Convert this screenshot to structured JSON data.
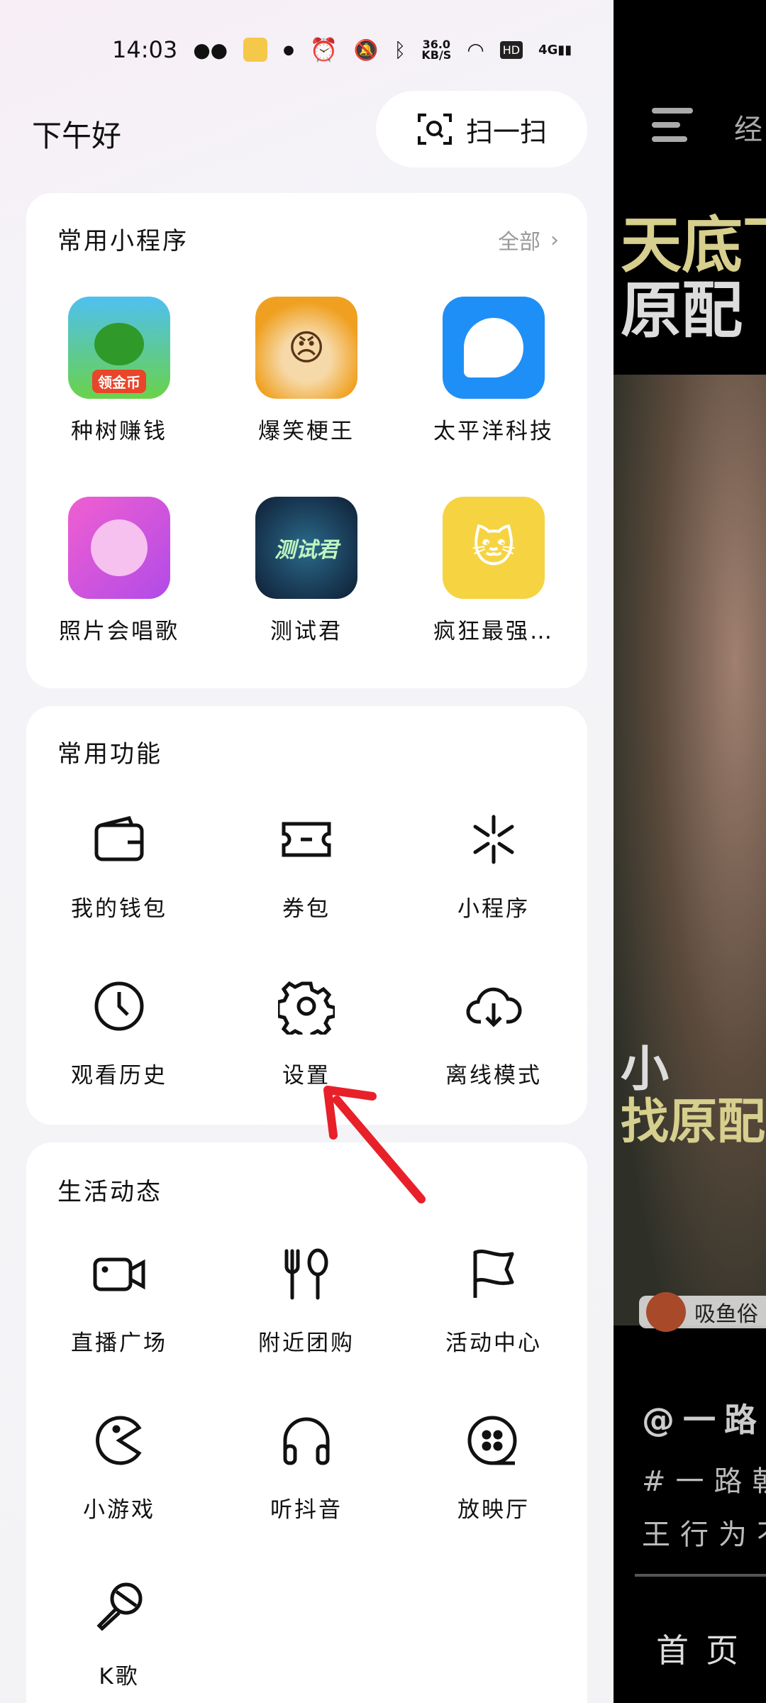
{
  "status_bar": {
    "time": "14:03",
    "net_speed": "36.0",
    "net_unit": "KB/S",
    "network": "4G"
  },
  "header": {
    "greeting": "下午好",
    "scan_label": "扫一扫"
  },
  "mini_programs": {
    "title": "常用小程序",
    "all_label": "全部",
    "items": [
      {
        "label": "种树赚钱",
        "icon": "money-tree",
        "color": "#3fae3a"
      },
      {
        "label": "爆笑梗王",
        "icon": "cartoon-face",
        "color": "#f0a020"
      },
      {
        "label": "太平洋科技",
        "icon": "chat-bird",
        "color": "#1e8ff7"
      },
      {
        "label": "照片会唱歌",
        "icon": "microphone-planet",
        "color": "#d84fe0"
      },
      {
        "label": "测试君",
        "icon": "test-logo",
        "color": "#1b3556"
      },
      {
        "label": "疯狂最强…",
        "icon": "cartoon-cat",
        "color": "#f6d341"
      }
    ],
    "coin_badge": "领金币",
    "test_badge": "测试君"
  },
  "functions": {
    "title": "常用功能",
    "items": [
      {
        "label": "我的钱包",
        "icon": "wallet-icon"
      },
      {
        "label": "券包",
        "icon": "ticket-icon"
      },
      {
        "label": "小程序",
        "icon": "mini-program-icon"
      },
      {
        "label": "观看历史",
        "icon": "clock-icon"
      },
      {
        "label": "设置",
        "icon": "gear-icon"
      },
      {
        "label": "离线模式",
        "icon": "cloud-download-icon"
      }
    ]
  },
  "life": {
    "title": "生活动态",
    "items": [
      {
        "label": "直播广场",
        "icon": "video-camera-icon"
      },
      {
        "label": "附近团购",
        "icon": "fork-spoon-icon"
      },
      {
        "label": "活动中心",
        "icon": "flag-icon"
      },
      {
        "label": "小游戏",
        "icon": "pacman-icon"
      },
      {
        "label": "听抖音",
        "icon": "headphones-icon"
      },
      {
        "label": "放映厅",
        "icon": "film-reel-icon"
      },
      {
        "label": "K歌",
        "icon": "microphone-icon"
      }
    ]
  },
  "background_feed": {
    "top_tab": "经",
    "caption_top": [
      "天底下",
      "原配"
    ],
    "caption_bottom": [
      "小",
      "找原配"
    ],
    "tag": "吸鱼俗",
    "author": "@一路朝",
    "hashtag": "#一路朝",
    "desc": "王行为不",
    "nav": "首页"
  },
  "annotation": {
    "arrow_color": "#e8202a"
  }
}
